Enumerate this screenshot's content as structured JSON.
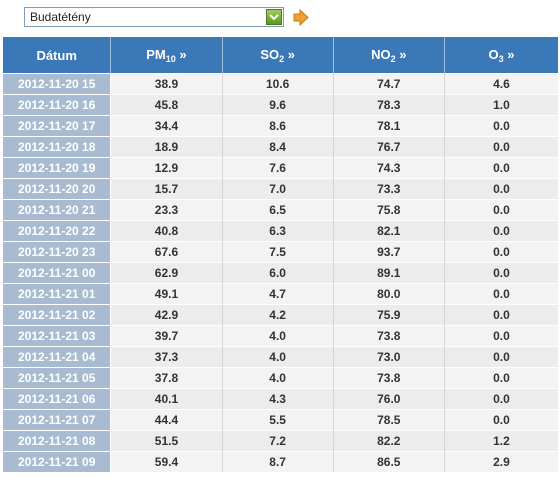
{
  "station_select": {
    "value": "Budatétény"
  },
  "colors": {
    "header": "#3b78b8",
    "date_cell": "#a8bbd0",
    "go_arrow": "#f0a030"
  },
  "table": {
    "headers": [
      {
        "label": "Dátum",
        "sub": "",
        "suffix": ""
      },
      {
        "label": "PM",
        "sub": "10",
        "suffix": " »"
      },
      {
        "label": "SO",
        "sub": "2",
        "suffix": " »"
      },
      {
        "label": "NO",
        "sub": "2",
        "suffix": " »"
      },
      {
        "label": "O",
        "sub": "3",
        "suffix": " »"
      }
    ],
    "rows": [
      [
        "2012-11-20 15",
        "38.9",
        "10.6",
        "74.7",
        "4.6"
      ],
      [
        "2012-11-20 16",
        "45.8",
        "9.6",
        "78.3",
        "1.0"
      ],
      [
        "2012-11-20 17",
        "34.4",
        "8.6",
        "78.1",
        "0.0"
      ],
      [
        "2012-11-20 18",
        "18.9",
        "8.4",
        "76.7",
        "0.0"
      ],
      [
        "2012-11-20 19",
        "12.9",
        "7.6",
        "74.3",
        "0.0"
      ],
      [
        "2012-11-20 20",
        "15.7",
        "7.0",
        "73.3",
        "0.0"
      ],
      [
        "2012-11-20 21",
        "23.3",
        "6.5",
        "75.8",
        "0.0"
      ],
      [
        "2012-11-20 22",
        "40.8",
        "6.3",
        "82.1",
        "0.0"
      ],
      [
        "2012-11-20 23",
        "67.6",
        "7.5",
        "93.7",
        "0.0"
      ],
      [
        "2012-11-21 00",
        "62.9",
        "6.0",
        "89.1",
        "0.0"
      ],
      [
        "2012-11-21 01",
        "49.1",
        "4.7",
        "80.0",
        "0.0"
      ],
      [
        "2012-11-21 02",
        "42.9",
        "4.2",
        "75.9",
        "0.0"
      ],
      [
        "2012-11-21 03",
        "39.7",
        "4.0",
        "73.8",
        "0.0"
      ],
      [
        "2012-11-21 04",
        "37.3",
        "4.0",
        "73.0",
        "0.0"
      ],
      [
        "2012-11-21 05",
        "37.8",
        "4.0",
        "73.8",
        "0.0"
      ],
      [
        "2012-11-21 06",
        "40.1",
        "4.3",
        "76.0",
        "0.0"
      ],
      [
        "2012-11-21 07",
        "44.4",
        "5.5",
        "78.5",
        "0.0"
      ],
      [
        "2012-11-21 08",
        "51.5",
        "7.2",
        "82.2",
        "1.2"
      ],
      [
        "2012-11-21 09",
        "59.4",
        "8.7",
        "86.5",
        "2.9"
      ]
    ]
  }
}
